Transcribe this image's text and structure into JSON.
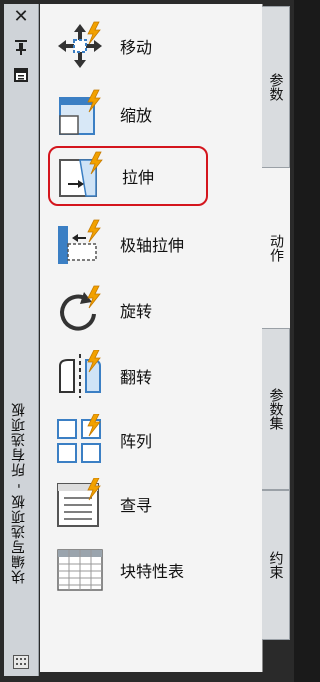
{
  "palette_title": "块编写选项板 - 所有选项板",
  "titlebar_icons": [
    "close-icon",
    "auto-hide-icon",
    "properties-icon"
  ],
  "tools": [
    {
      "id": "move",
      "label": "移动",
      "icon": "move-icon"
    },
    {
      "id": "scale",
      "label": "缩放",
      "icon": "scale-icon"
    },
    {
      "id": "stretch",
      "label": "拉伸",
      "icon": "stretch-icon",
      "selected": true
    },
    {
      "id": "polar-stretch",
      "label": "极轴拉伸",
      "icon": "polar-stretch-icon"
    },
    {
      "id": "rotate",
      "label": "旋转",
      "icon": "rotate-icon"
    },
    {
      "id": "flip",
      "label": "翻转",
      "icon": "flip-icon"
    },
    {
      "id": "array",
      "label": "阵列",
      "icon": "array-icon"
    },
    {
      "id": "lookup",
      "label": "查寻",
      "icon": "lookup-icon"
    },
    {
      "id": "block-properties-table",
      "label": "块特性表",
      "icon": "table-icon"
    }
  ],
  "tabs": [
    {
      "id": "parameters",
      "label": "参数"
    },
    {
      "id": "actions",
      "label": "动作",
      "active": true
    },
    {
      "id": "parameter-sets",
      "label": "参数集"
    },
    {
      "id": "constraints",
      "label": "约束"
    }
  ],
  "colors": {
    "highlight": "#d4151d",
    "icon_blue": "#3b7fc4",
    "bolt": "#f2a100"
  }
}
